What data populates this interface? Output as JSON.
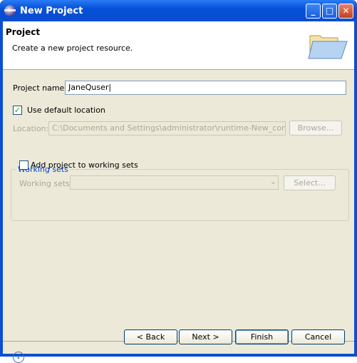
{
  "window": {
    "title": "New Project"
  },
  "header": {
    "title": "Project",
    "description": "Create a new project resource."
  },
  "form": {
    "project_name_label": "Project name:",
    "project_name_value": "JaneQuser",
    "use_default_label": "Use default location",
    "use_default_checked": true,
    "location_label": "Location:",
    "location_value": "C:\\Documents and Settings\\administrator\\runtime-New_configurati",
    "browse_label": "Browse..."
  },
  "working_sets": {
    "group_label": "Working sets",
    "add_label": "Add project to working sets",
    "add_checked": false,
    "sets_label": "Working sets:",
    "select_label": "Select..."
  },
  "footer": {
    "help": "?",
    "back": "< Back",
    "next": "Next >",
    "finish": "Finish",
    "cancel": "Cancel"
  }
}
